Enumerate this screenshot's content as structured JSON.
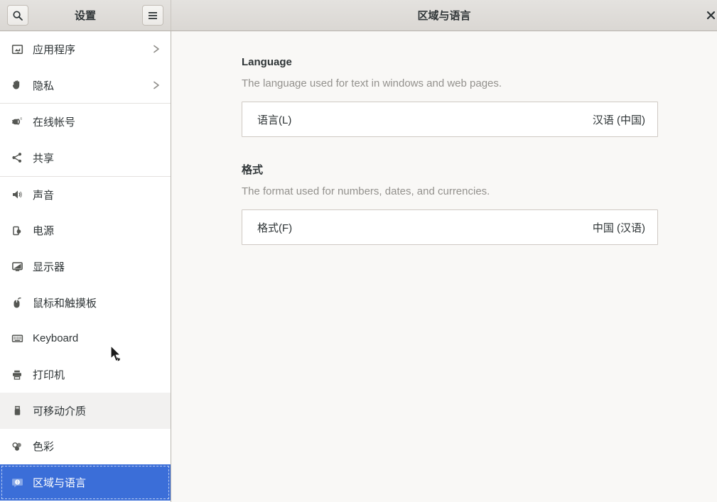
{
  "window": {
    "sidebar_title": "设置",
    "main_title": "区域与语言",
    "close_label": "close-window"
  },
  "colors": {
    "accent_blue": "#3b6ed8",
    "headerbar_top": "#e4e2df",
    "headerbar_bottom": "#dad7d3",
    "sidebar_bg": "#ffffff",
    "main_bg": "#f9f8f6",
    "hover_row": "#f2f1f0",
    "text_dark": "#2e3436",
    "text_muted": "#93918d"
  },
  "icons": {
    "search": "search-icon (magnifier)",
    "menu": "hamburger-menu-icon",
    "close": "close-x-icon",
    "chevron": "chevron-right-icon"
  },
  "sidebar": {
    "items": [
      {
        "label": "应用程序",
        "icon": "applications-icon",
        "chevron": true,
        "state": "normal"
      },
      {
        "label": "隐私",
        "icon": "privacy-icon",
        "chevron": true,
        "state": "normal"
      },
      {
        "label": "在线帐号",
        "icon": "online-accounts-icon",
        "chevron": false,
        "state": "normal"
      },
      {
        "label": "共享",
        "icon": "sharing-icon",
        "chevron": false,
        "state": "normal"
      },
      {
        "label": "声音",
        "icon": "sound-icon",
        "chevron": false,
        "state": "normal"
      },
      {
        "label": "电源",
        "icon": "power-icon",
        "chevron": false,
        "state": "normal"
      },
      {
        "label": "显示器",
        "icon": "displays-icon",
        "chevron": false,
        "state": "normal"
      },
      {
        "label": "鼠标和触摸板",
        "icon": "mouse-touchpad-icon",
        "chevron": false,
        "state": "normal"
      },
      {
        "label": "Keyboard",
        "icon": "keyboard-icon",
        "chevron": false,
        "state": "normal"
      },
      {
        "label": "打印机",
        "icon": "printers-icon",
        "chevron": false,
        "state": "normal"
      },
      {
        "label": "可移动介质",
        "icon": "removable-media-icon",
        "chevron": false,
        "state": "hovered"
      },
      {
        "label": "色彩",
        "icon": "color-icon",
        "chevron": false,
        "state": "normal"
      },
      {
        "label": "区域与语言",
        "icon": "region-language-icon",
        "chevron": false,
        "state": "selected"
      }
    ]
  },
  "main": {
    "sections": [
      {
        "title": "Language",
        "description": "The language used for text in windows and web pages.",
        "row": {
          "label": "语言(L)",
          "value": "汉语 (中国)"
        }
      },
      {
        "title": "格式",
        "description": "The format used for numbers, dates, and currencies.",
        "row": {
          "label": "格式(F)",
          "value": "中国 (汉语)"
        }
      }
    ]
  }
}
